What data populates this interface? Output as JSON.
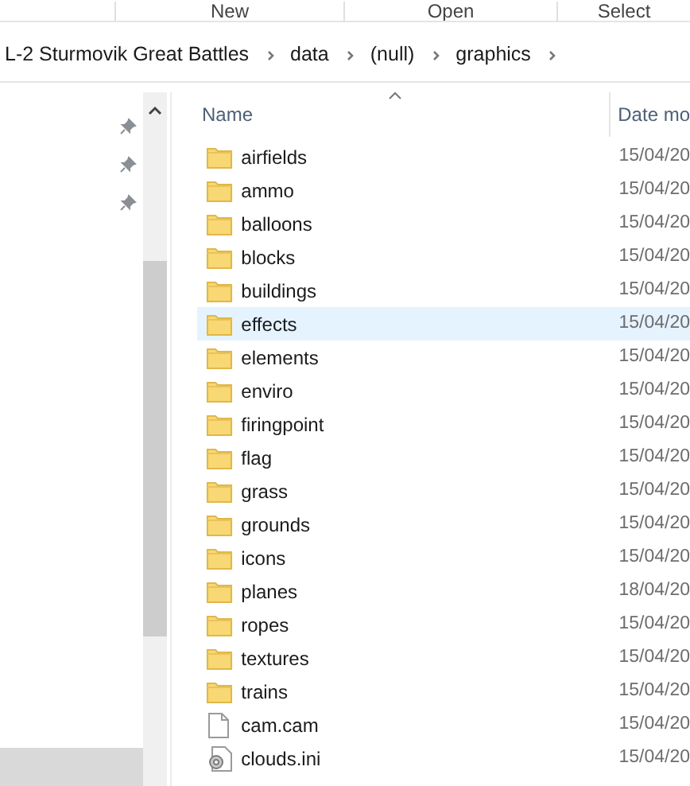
{
  "ribbon": {
    "labels": [
      "New",
      "Open",
      "Select"
    ]
  },
  "breadcrumb": [
    "L-2 Sturmovik Great Battles",
    "data",
    "(null)",
    "graphics"
  ],
  "columns": [
    {
      "label": "Name",
      "sorted": true
    },
    {
      "label": "Date mo",
      "sorted": false
    }
  ],
  "files": [
    {
      "name": "airfields",
      "date": "15/04/20",
      "kind": "folder",
      "selected": false
    },
    {
      "name": "ammo",
      "date": "15/04/20",
      "kind": "folder",
      "selected": false
    },
    {
      "name": "balloons",
      "date": "15/04/20",
      "kind": "folder",
      "selected": false
    },
    {
      "name": "blocks",
      "date": "15/04/20",
      "kind": "folder",
      "selected": false
    },
    {
      "name": "buildings",
      "date": "15/04/20",
      "kind": "folder",
      "selected": false
    },
    {
      "name": "effects",
      "date": "15/04/20",
      "kind": "folder",
      "selected": true
    },
    {
      "name": "elements",
      "date": "15/04/20",
      "kind": "folder",
      "selected": false
    },
    {
      "name": "enviro",
      "date": "15/04/20",
      "kind": "folder",
      "selected": false
    },
    {
      "name": "firingpoint",
      "date": "15/04/20",
      "kind": "folder",
      "selected": false
    },
    {
      "name": "flag",
      "date": "15/04/20",
      "kind": "folder",
      "selected": false
    },
    {
      "name": "grass",
      "date": "15/04/20",
      "kind": "folder",
      "selected": false
    },
    {
      "name": "grounds",
      "date": "15/04/20",
      "kind": "folder",
      "selected": false
    },
    {
      "name": "icons",
      "date": "15/04/20",
      "kind": "folder",
      "selected": false
    },
    {
      "name": "planes",
      "date": "18/04/20",
      "kind": "folder",
      "selected": false
    },
    {
      "name": "ropes",
      "date": "15/04/20",
      "kind": "folder",
      "selected": false
    },
    {
      "name": "textures",
      "date": "15/04/20",
      "kind": "folder",
      "selected": false
    },
    {
      "name": "trains",
      "date": "15/04/20",
      "kind": "folder",
      "selected": false
    },
    {
      "name": "cam.cam",
      "date": "15/04/20",
      "kind": "file",
      "selected": false
    },
    {
      "name": "clouds.ini",
      "date": "15/04/20",
      "kind": "settings",
      "selected": false
    }
  ]
}
